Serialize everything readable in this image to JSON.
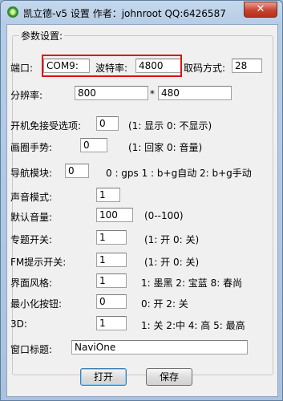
{
  "window": {
    "title": "凯立德-v5 设置  作者：johnroot  QQ:6426587",
    "close_label": "✕"
  },
  "group": {
    "title": "参数设置:"
  },
  "port": {
    "label": "端口:",
    "value": "COM9:"
  },
  "baud": {
    "label": "波特率:",
    "value": "4800"
  },
  "fetch_mode": {
    "label": "取码方式:",
    "value": "28"
  },
  "resolution": {
    "label": "分辨率:",
    "width": "800",
    "separator": "*",
    "height": "480"
  },
  "skip_option": {
    "label": "开机免接受选项:",
    "value": "0",
    "hint": "(1: 显示 0: 不显示)"
  },
  "circle_gesture": {
    "label": "画圈手势:",
    "value": "0",
    "hint": "(1: 回家 0: 音量)"
  },
  "nav_module": {
    "label": "导航模块:",
    "value": "0",
    "hint": "0 : gps  1 : b+g自动  2: b+g手动"
  },
  "voice_mode": {
    "label": "声音模式:",
    "value": "1"
  },
  "default_volume": {
    "label": "默认音量:",
    "value": "100",
    "hint": "(0--100)"
  },
  "topic_switch": {
    "label": "专题开关:",
    "value": "1",
    "hint": "(1: 开 0: 关)"
  },
  "fm_switch": {
    "label": "FM提示开关:",
    "value": "1",
    "hint": "(1: 开 0: 关)"
  },
  "ui_style": {
    "label": "界面风格:",
    "value": "1",
    "hint": "1: 墨黑  2: 宝蓝  8: 春尚"
  },
  "minimize_btn": {
    "label": "最小化按钮:",
    "value": "0",
    "hint": "0: 开 2: 关"
  },
  "three_d": {
    "label": "3D:",
    "value": "1",
    "hint": "1: 关 2:中 4: 高 5: 最高"
  },
  "window_title": {
    "label": "窗口标题:",
    "value": "NaviOne"
  },
  "buttons": {
    "open": "打开",
    "save": "保存"
  }
}
